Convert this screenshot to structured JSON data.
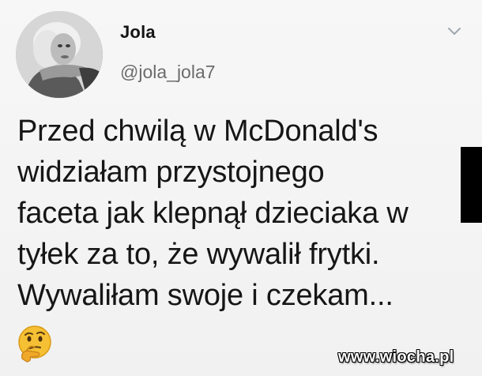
{
  "tweet": {
    "display_name": "Jola",
    "handle": "@jola_jola7",
    "text": "Przed chwilą w McDonald's\nwidziałam  przystojnego\nfaceta jak klepnął dzieciaka w\ntyłek za to, że wywalił frytki.\nWywaliłam swoje i czekam...",
    "emoji": "thinking-face"
  },
  "watermark": {
    "text": "www.wiocha.pl"
  },
  "icons": {
    "menu": "chevron-down-icon",
    "avatar": "profile-photo"
  },
  "colors": {
    "background": "#f4f4f4",
    "text": "#161616",
    "handle": "#6b6b6b",
    "emoji_face": "#f5c033"
  }
}
